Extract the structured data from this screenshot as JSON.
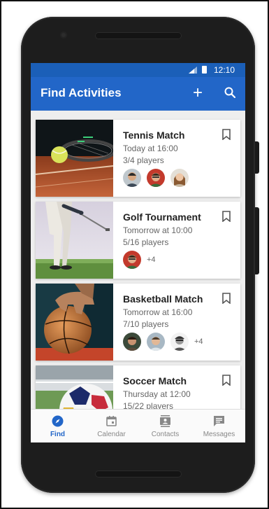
{
  "status_bar": {
    "time": "12:10"
  },
  "app_bar": {
    "title": "Find Activities",
    "add_icon": "plus-icon",
    "search_icon": "search-icon"
  },
  "activities": [
    {
      "title": "Tennis Match",
      "time": "Today at 16:00",
      "players": "3/4 players",
      "extra": ""
    },
    {
      "title": "Golf Tournament",
      "time": "Tomorrow at 10:00",
      "players": "5/16 players",
      "extra": "+4"
    },
    {
      "title": "Basketball Match",
      "time": "Tomorrow at 16:00",
      "players": "7/10 players",
      "extra": "+4"
    },
    {
      "title": "Soccer Match",
      "time": "Thursday at 12:00",
      "players": "15/22 players",
      "extra": ""
    }
  ],
  "bottom_nav": [
    {
      "label": "Find",
      "icon": "compass-icon",
      "active": true
    },
    {
      "label": "Calendar",
      "icon": "calendar-icon",
      "active": false
    },
    {
      "label": "Contacts",
      "icon": "contacts-icon",
      "active": false
    },
    {
      "label": "Messages",
      "icon": "messages-icon",
      "active": false
    }
  ],
  "colors": {
    "primary": "#2266c8",
    "status_bar": "#1b5fb8",
    "inactive": "#888888"
  }
}
